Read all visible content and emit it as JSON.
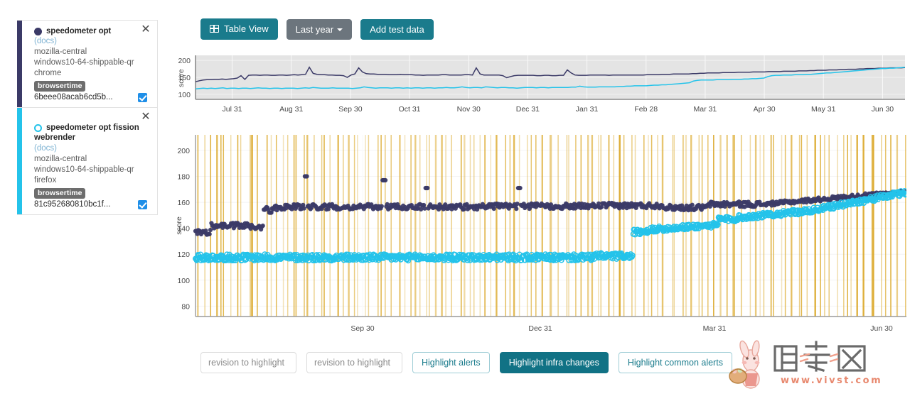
{
  "legend": {
    "cards": [
      {
        "stripe_color": "#3b3a67",
        "marker": "filled-circle",
        "title": "speedometer opt",
        "bold_sub": "",
        "docs_label": "(docs)",
        "repo": "mozilla-central",
        "platform": "windows10-64-shippable-qr",
        "browser": "chrome",
        "framework_tag": "browsertime",
        "revision": "6beee08acab6cd5b...",
        "checkbox_checked": true,
        "close_label": "✕"
      },
      {
        "stripe_color": "#24c3ea",
        "marker": "hollow-circle",
        "title": "speedometer opt fission",
        "bold_sub": "webrender",
        "docs_label": "(docs)",
        "repo": "mozilla-central",
        "platform": "windows10-64-shippable-qr",
        "browser": "firefox",
        "framework_tag": "browsertime",
        "revision": "81c952680810bc1f...",
        "checkbox_checked": true,
        "close_label": "✕"
      }
    ]
  },
  "toolbar": {
    "table_view_label": "Table View",
    "table_view_icon": "table-grid-icon",
    "timerange_label": "Last year",
    "timerange_caret_icon": "caret-down-icon",
    "add_test_data_label": "Add test data"
  },
  "bottom_controls": {
    "revision_input_1_placeholder": "revision to highlight",
    "revision_input_1_value": "",
    "revision_input_2_placeholder": "revision to highlight",
    "revision_input_2_value": "",
    "highlight_alerts_label": "Highlight alerts",
    "highlight_infra_label": "Highlight infra changes",
    "highlight_common_label": "Highlight common alerts",
    "highlight_infra_active": true
  },
  "watermark": {
    "site": "www.vivst.com",
    "logo_text": "唯爱网"
  },
  "colors": {
    "series_1": "#3b3a67",
    "series_2": "#24c3ea",
    "teal_accent": "#1a7b8c",
    "infra_line": "#daa520",
    "overview_bg": "#e4e4e4"
  },
  "chart_data": [
    {
      "id": "overview",
      "type": "line",
      "title": "",
      "xlabel": "",
      "ylabel": "score",
      "ylim": [
        85,
        215
      ],
      "yticks": [
        100,
        150,
        200
      ],
      "xticks": [
        "Jul 31",
        "Aug 31",
        "Sep 30",
        "Oct 31",
        "Nov 30",
        "Dec 31",
        "Jan 31",
        "Feb 28",
        "Mar 31",
        "Apr 30",
        "May 31",
        "Jun 30"
      ],
      "grid": true,
      "legend_position": "external-left",
      "selection": "full-range",
      "series": [
        {
          "name": "speedometer opt",
          "color": "#3b3a67",
          "values": [
            137,
            140,
            142,
            143,
            143,
            144,
            144,
            145,
            144,
            145,
            146,
            148,
            155,
            144,
            156,
            157,
            157,
            156,
            157,
            157,
            156,
            156,
            157,
            157,
            156,
            157,
            158,
            157,
            158,
            159,
            180,
            162,
            159,
            158,
            158,
            157,
            157,
            156,
            156,
            155,
            150,
            157,
            160,
            178,
            166,
            161,
            160,
            160,
            159,
            159,
            159,
            158,
            158,
            158,
            159,
            158,
            158,
            158,
            157,
            157,
            156,
            157,
            157,
            157,
            157,
            158,
            158,
            157,
            157,
            157,
            157,
            158,
            158,
            157,
            178,
            160,
            157,
            157,
            157,
            157,
            157,
            155,
            149,
            152,
            155,
            156,
            156,
            156,
            156,
            156,
            155,
            155,
            156,
            156,
            155,
            155,
            156,
            156,
            172,
            163,
            157,
            156,
            156,
            156,
            157,
            157,
            157,
            157,
            157,
            156,
            157,
            157,
            157,
            157,
            157,
            157,
            157,
            157,
            157,
            158,
            158,
            158,
            158,
            159,
            159,
            159,
            160,
            160,
            160,
            160,
            160,
            161,
            161,
            162,
            162,
            163,
            163,
            163,
            163,
            164,
            164,
            164,
            164,
            165,
            165,
            165,
            165,
            166,
            166,
            166,
            166,
            167,
            167,
            167,
            167,
            168,
            168,
            168,
            168,
            169,
            169,
            169,
            170,
            170,
            171,
            171,
            171,
            172,
            172,
            172,
            173,
            173,
            174,
            174,
            174,
            175,
            175,
            176,
            176,
            176,
            177,
            177,
            177,
            178,
            178,
            178,
            178,
            179
          ]
        },
        {
          "name": "speedometer opt fission webrender",
          "color": "#24c3ea",
          "values": [
            116,
            117,
            118,
            117,
            118,
            117,
            118,
            119,
            117,
            118,
            118,
            117,
            118,
            118,
            117,
            118,
            119,
            118,
            118,
            117,
            118,
            118,
            117,
            118,
            118,
            118,
            117,
            118,
            119,
            118,
            120,
            119,
            118,
            118,
            118,
            119,
            118,
            118,
            118,
            118,
            117,
            118,
            119,
            122,
            120,
            119,
            118,
            119,
            119,
            119,
            118,
            119,
            119,
            118,
            119,
            118,
            119,
            119,
            118,
            119,
            119,
            118,
            119,
            119,
            120,
            119,
            119,
            120,
            122,
            120,
            119,
            120,
            120,
            119,
            122,
            121,
            120,
            119,
            120,
            120,
            119,
            119,
            118,
            119,
            120,
            120,
            120,
            119,
            120,
            120,
            119,
            120,
            120,
            120,
            120,
            120,
            121,
            121,
            124,
            122,
            121,
            121,
            121,
            122,
            122,
            122,
            122,
            122,
            123,
            123,
            124,
            124,
            125,
            125,
            125,
            125,
            126,
            127,
            127,
            128,
            128,
            129,
            130,
            131,
            132,
            133,
            134,
            139,
            141,
            142,
            142,
            142,
            142,
            143,
            143,
            143,
            143,
            144,
            144,
            144,
            145,
            145,
            146,
            146,
            147,
            148,
            152,
            155,
            156,
            156,
            157,
            157,
            157,
            158,
            158,
            158,
            159,
            159,
            160,
            161,
            162,
            163,
            163,
            164,
            165,
            166,
            167,
            168,
            169,
            170,
            171,
            172,
            173,
            174,
            175,
            176,
            176,
            177,
            177,
            178,
            179,
            180
          ]
        }
      ]
    },
    {
      "id": "main",
      "type": "scatter",
      "title": "",
      "xlabel": "",
      "ylabel": "score",
      "ylim": [
        72,
        212
      ],
      "yticks": [
        80,
        100,
        120,
        140,
        160,
        180,
        200
      ],
      "xticks": [
        "Sep 30",
        "Dec 31",
        "Mar 31",
        "Jun 30"
      ],
      "xtick_positions": [
        0.235,
        0.485,
        0.73,
        0.965
      ],
      "grid": true,
      "infra_change_lines": true,
      "series": [
        {
          "name": "speedometer opt",
          "color": "#3b3a67",
          "marker": "filled-circle",
          "description": "Dark navy filled dots starting near 137 rising to ~142 plateau, stepping to ~157 plateau with occasional spikes to 180, 177, 171, then a dense band climbing from ~158 to ~168 at the right edge"
        },
        {
          "name": "speedometer opt fission webrender",
          "color": "#24c3ea",
          "marker": "hollow-circle",
          "description": "Cyan hollow circles in a dense band near 118 for the first half, stepping up at ~Feb to ~140, then climbing steadily to ~168 converging with the navy series at the right edge"
        }
      ]
    }
  ]
}
